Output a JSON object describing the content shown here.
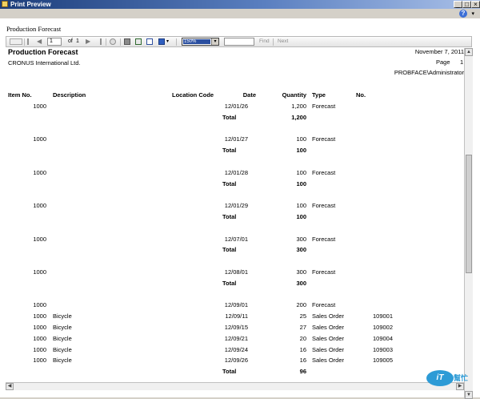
{
  "window": {
    "title": "Print Preview",
    "min_label": "_",
    "max_label": "□",
    "close_label": "×"
  },
  "menubar": {
    "help_label": "?",
    "help_dropdown": "▾"
  },
  "report_header_title": "Production Forecast",
  "toolbar": {
    "page_current": "1",
    "page_of_label": "of",
    "page_total": "1",
    "zoom_value": "150%",
    "zoom_dropdown": "▾",
    "find_label": "Find",
    "next_label": "Next",
    "icons": [
      "document-map-icon",
      "first-page-icon",
      "previous-page-icon",
      "next-page-icon",
      "last-page-icon",
      "stop-icon",
      "print-icon",
      "print-layout-icon",
      "page-setup-icon",
      "export-icon"
    ]
  },
  "report": {
    "title": "Production Forecast",
    "company": "CRONUS International Ltd.",
    "date": "November 7, 2011",
    "page_label": "Page",
    "page_number": "1",
    "user": "PROBFACE\\Administrator",
    "columns": [
      "Item No.",
      "Description",
      "Location Code",
      "Date",
      "Quantity",
      "Type",
      "No."
    ],
    "total_label": "Total",
    "groups": [
      {
        "rows": [
          {
            "item": "1000",
            "desc": "",
            "date": "12/01/26",
            "qty": "1,200",
            "type": "Forecast",
            "no": ""
          }
        ],
        "total": "1,200"
      },
      {
        "rows": [
          {
            "item": "1000",
            "desc": "",
            "date": "12/01/27",
            "qty": "100",
            "type": "Forecast",
            "no": ""
          }
        ],
        "total": "100"
      },
      {
        "rows": [
          {
            "item": "1000",
            "desc": "",
            "date": "12/01/28",
            "qty": "100",
            "type": "Forecast",
            "no": ""
          }
        ],
        "total": "100"
      },
      {
        "rows": [
          {
            "item": "1000",
            "desc": "",
            "date": "12/01/29",
            "qty": "100",
            "type": "Forecast",
            "no": ""
          }
        ],
        "total": "100"
      },
      {
        "rows": [
          {
            "item": "1000",
            "desc": "",
            "date": "12/07/01",
            "qty": "300",
            "type": "Forecast",
            "no": ""
          }
        ],
        "total": "300"
      },
      {
        "rows": [
          {
            "item": "1000",
            "desc": "",
            "date": "12/08/01",
            "qty": "300",
            "type": "Forecast",
            "no": ""
          }
        ],
        "total": "300"
      },
      {
        "rows": [
          {
            "item": "1000",
            "desc": "",
            "date": "12/09/01",
            "qty": "200",
            "type": "Forecast",
            "no": ""
          },
          {
            "item": "1000",
            "desc": "Bicycle",
            "date": "12/09/11",
            "qty": "25",
            "type": "Sales Order",
            "no": "109001"
          },
          {
            "item": "1000",
            "desc": "Bicycle",
            "date": "12/09/15",
            "qty": "27",
            "type": "Sales Order",
            "no": "109002"
          },
          {
            "item": "1000",
            "desc": "Bicycle",
            "date": "12/09/21",
            "qty": "20",
            "type": "Sales Order",
            "no": "109004"
          },
          {
            "item": "1000",
            "desc": "Bicycle",
            "date": "12/09/24",
            "qty": "16",
            "type": "Sales Order",
            "no": "109003"
          },
          {
            "item": "1000",
            "desc": "Bicycle",
            "date": "12/09/26",
            "qty": "16",
            "type": "Sales Order",
            "no": "109005"
          }
        ],
        "total": "96"
      }
    ]
  },
  "watermark": {
    "logo_text": "iT",
    "logo_text2": "幫忙",
    "color": "#2d9bd6"
  }
}
